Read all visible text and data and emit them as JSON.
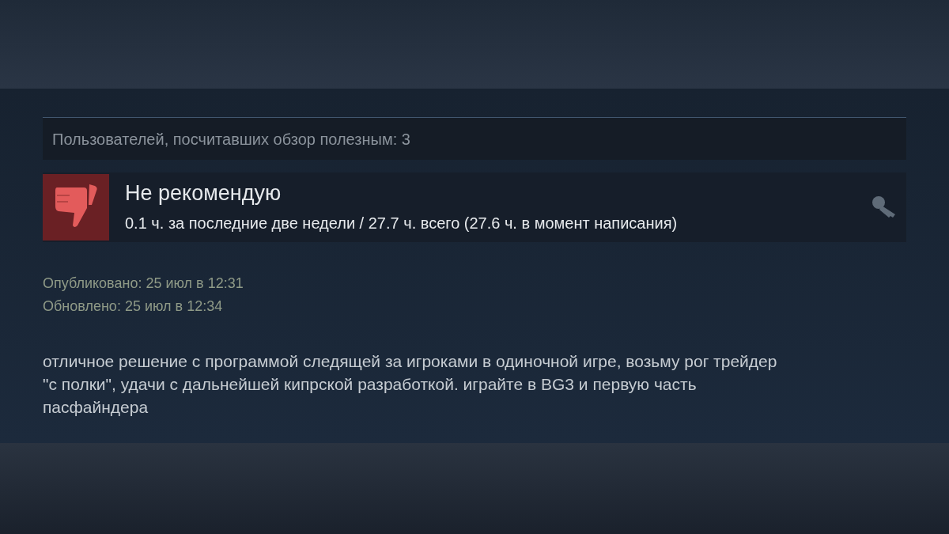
{
  "helpful": "Пользователей, посчитавших обзор полезным: 3",
  "review": {
    "recommended": false,
    "title": "Не рекомендую",
    "hours": "0.1 ч. за последние две недели / 27.7 ч. всего (27.6 ч. в момент написания)"
  },
  "dates": [
    "Опубликовано: 25 июл в 12:31",
    "Обновлено: 25 июл в 12:34"
  ],
  "body": "отличное решение с программой следящей за игроками в одиночной игре, возьму рог трейдер \"с полки\", удачи с дальнейшей кипрской разработкой. играйте в BG3 и первую часть пасфайндера"
}
